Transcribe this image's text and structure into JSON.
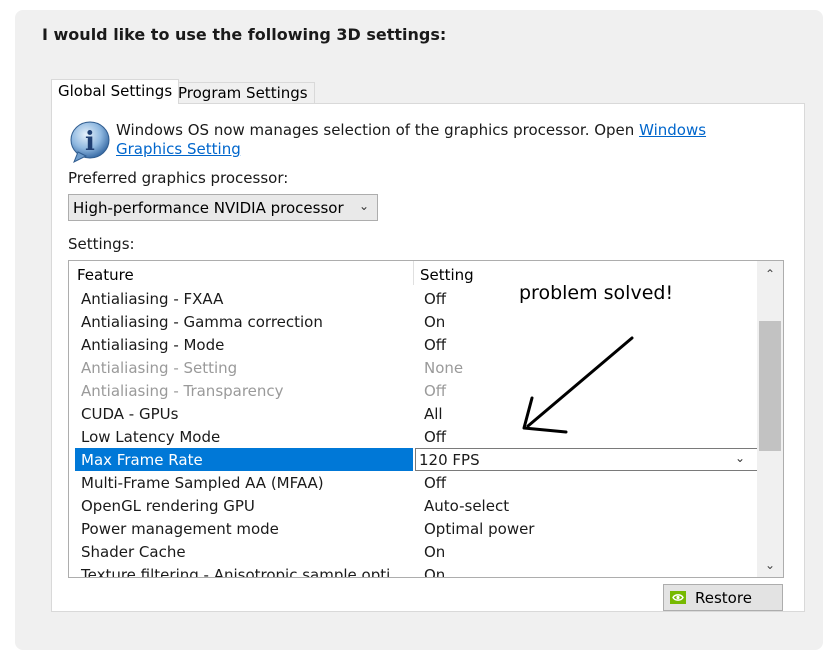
{
  "heading": "I would like to use the following 3D settings:",
  "tabs": [
    {
      "label": "Global Settings",
      "active": true
    },
    {
      "label": "Program Settings",
      "active": false
    }
  ],
  "info": {
    "text": "Windows OS now manages selection of the graphics processor. Open ",
    "link": "Windows Graphics Setting"
  },
  "preferred_label": "Preferred graphics processor:",
  "preferred_value": "High-performance NVIDIA processor",
  "settings_label": "Settings:",
  "table": {
    "header_feature": "Feature",
    "header_setting": "Setting",
    "rows": [
      {
        "feature": "Antialiasing - FXAA",
        "setting": "Off",
        "state": "normal"
      },
      {
        "feature": "Antialiasing - Gamma correction",
        "setting": "On",
        "state": "normal"
      },
      {
        "feature": "Antialiasing - Mode",
        "setting": "Off",
        "state": "normal"
      },
      {
        "feature": "Antialiasing - Setting",
        "setting": "None",
        "state": "disabled"
      },
      {
        "feature": "Antialiasing - Transparency",
        "setting": "Off",
        "state": "disabled"
      },
      {
        "feature": "CUDA - GPUs",
        "setting": "All",
        "state": "normal"
      },
      {
        "feature": "Low Latency Mode",
        "setting": "Off",
        "state": "normal"
      },
      {
        "feature": "Max Frame Rate",
        "setting": "120 FPS",
        "state": "selected"
      },
      {
        "feature": "Multi-Frame Sampled AA (MFAA)",
        "setting": "Off",
        "state": "normal"
      },
      {
        "feature": "OpenGL rendering GPU",
        "setting": "Auto-select",
        "state": "normal"
      },
      {
        "feature": "Power management mode",
        "setting": "Optimal power",
        "state": "normal"
      },
      {
        "feature": "Shader Cache",
        "setting": "On",
        "state": "normal"
      },
      {
        "feature": "Texture filtering - Anisotropic sample opti",
        "setting": "On",
        "state": "normal"
      }
    ]
  },
  "annotation": "problem solved!",
  "restore_label": "Restore",
  "colors": {
    "selection": "#0078d7",
    "link": "#0066cc",
    "nvidia": "#76b900"
  }
}
